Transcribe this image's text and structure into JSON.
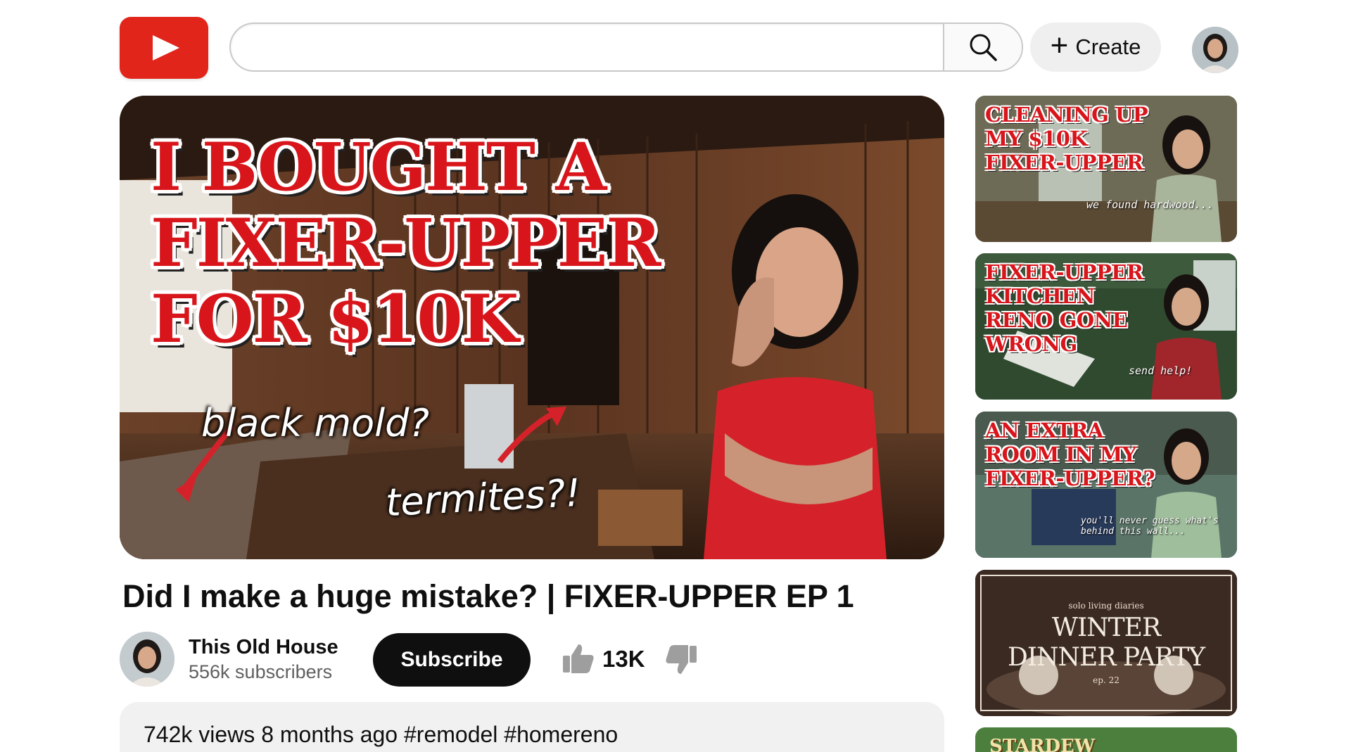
{
  "header": {
    "logo": "youtube-play-icon",
    "search": {
      "value": "",
      "placeholder": ""
    },
    "search_icon": "search-icon",
    "create_label": "Create",
    "create_icon": "plus-icon",
    "avatar": "user-avatar"
  },
  "hero": {
    "title_text": "I BOUGHT A\nFIXER-UPPER\nFOR $10K",
    "note_a": "black mold?",
    "note_b": "termites?!"
  },
  "video": {
    "title": "Did I make a huge mistake? | FIXER-UPPER EP 1",
    "channel_name": "This Old House",
    "subscribers": "556k subscribers",
    "subscribe_label": "Subscribe",
    "likes": "13K",
    "description": "742k views 8 months ago #remodel #homereno"
  },
  "sidebar": [
    {
      "title": "CLEANING UP\nMY $10K\nFIXER-UPPER",
      "note": "we found hardwood..."
    },
    {
      "title": "FIXER-UPPER\nKITCHEN\nRENO GONE\nWRONG",
      "note": "send help!"
    },
    {
      "title": "AN EXTRA\nROOM IN MY\nFIXER-UPPER?",
      "note": "you'll never guess what's\nbehind this wall..."
    },
    {
      "small": "solo living diaries",
      "title": "WINTER\nDINNER PARTY",
      "ep": "ep. 22"
    },
    {
      "title": "STARDEW"
    }
  ],
  "colors": {
    "brand_red": "#e1251b",
    "title_red": "#d8151b",
    "dark": "#0f0f0f",
    "desc_bg": "#f1f1f1"
  }
}
